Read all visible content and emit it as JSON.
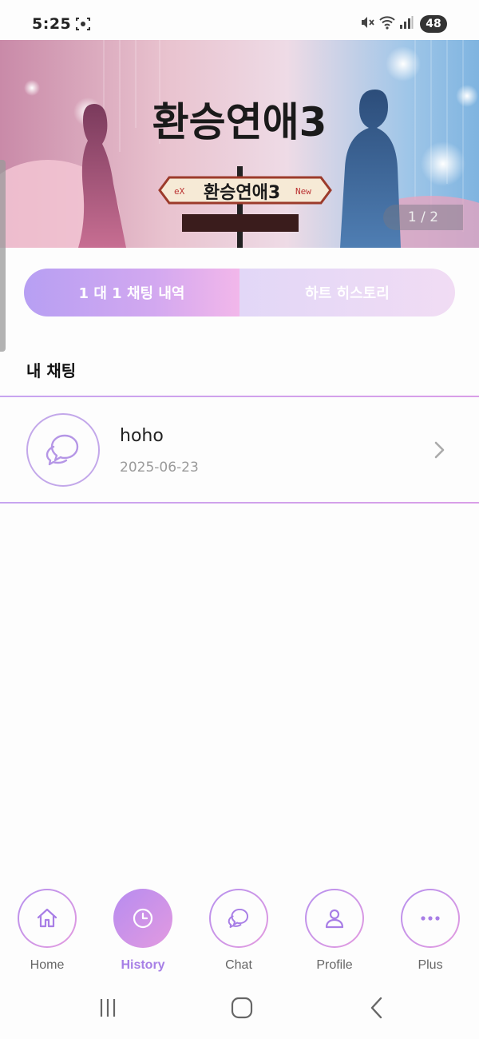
{
  "status_bar": {
    "time": "5:25",
    "battery": "48"
  },
  "banner": {
    "title": "환승연애3",
    "sign_text": "환승연애3",
    "sign_left": "eX",
    "sign_right": "New",
    "counter": "1 / 2"
  },
  "tabs": [
    {
      "label": "1 대 1 채팅 내역",
      "active": true
    },
    {
      "label": "하트 히스토리",
      "active": false
    }
  ],
  "section": {
    "title": "내 채팅"
  },
  "chats": [
    {
      "name": "hoho",
      "date": "2025-06-23"
    }
  ],
  "bottom_nav": [
    {
      "label": "Home",
      "icon": "home-icon",
      "active": false
    },
    {
      "label": "History",
      "icon": "clock-icon",
      "active": true
    },
    {
      "label": "Chat",
      "icon": "chat-bubbles-icon",
      "active": false
    },
    {
      "label": "Profile",
      "icon": "person-icon",
      "active": false
    },
    {
      "label": "Plus",
      "icon": "more-dots-icon",
      "active": false
    }
  ],
  "colors": {
    "accent": "#a77fe6",
    "gradient_start": "#b79ff3",
    "gradient_end": "#f2b7ea",
    "divider": "#c7a5f0"
  }
}
